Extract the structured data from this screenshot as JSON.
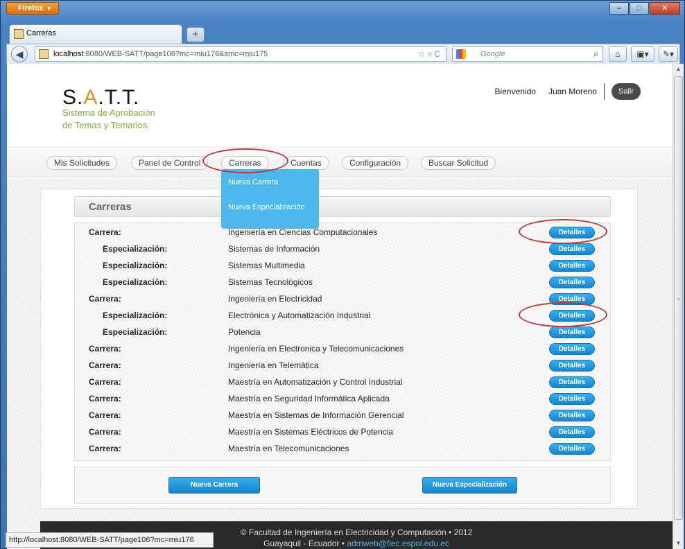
{
  "browser": {
    "app_menu": "Firefox",
    "tab_title": "Carreras",
    "new_tab": "+",
    "url_host": "localhost",
    "url_rest": ":8080/WEB-SATT/page106?mc=miu176&smc=miu175",
    "search_placeholder": "Google",
    "status_url": "http://localhost:8080/WEB-SATT/page106?mc=miu176"
  },
  "site": {
    "logo_s": "S.",
    "logo_a": "A",
    "logo_rest": ".T.T.",
    "tagline_1": "Sistema de Aprobación",
    "tagline_2": "de Temas y Temarios.",
    "welcome": "Bienvenido",
    "user_name": "Juan Moreno",
    "logout": "Salir"
  },
  "menu": {
    "items": [
      "Mis Solicitudes",
      "Panel de Control",
      "Carreras",
      "Cuentas",
      "Configuración",
      "Buscar Solicitud"
    ],
    "dropdown": [
      "Nueva Carrera",
      "Nueva Especialización"
    ]
  },
  "section": {
    "title": "Carreras",
    "detail_label": "Detalles",
    "rows": [
      {
        "label": "Carrera:",
        "type": "carrera",
        "value": "Ingeniería en Ciencias Computacionales"
      },
      {
        "label": "Especialización:",
        "type": "esp",
        "value": "Sistemas de Información"
      },
      {
        "label": "Especialización:",
        "type": "esp",
        "value": "Sistemas Multimedia"
      },
      {
        "label": "Especialización:",
        "type": "esp",
        "value": "Sistemas Tecnológicos"
      },
      {
        "label": "Carrera:",
        "type": "carrera",
        "value": "Ingeniería en Electricidad"
      },
      {
        "label": "Especialización:",
        "type": "esp",
        "value": "Electrónica y Automatización Industrial"
      },
      {
        "label": "Especialización:",
        "type": "esp",
        "value": "Potencia"
      },
      {
        "label": "Carrera:",
        "type": "carrera",
        "value": "Ingeniería en Electronica y Telecomunicaciones"
      },
      {
        "label": "Carrera:",
        "type": "carrera",
        "value": "Ingeniería en Telemática"
      },
      {
        "label": "Carrera:",
        "type": "carrera",
        "value": "Maestría en Automatización y Control Industrial"
      },
      {
        "label": "Carrera:",
        "type": "carrera",
        "value": "Maestría en Seguridad Informática Aplicada"
      },
      {
        "label": "Carrera:",
        "type": "carrera",
        "value": "Maestría en Sistemas de Información Gerencial"
      },
      {
        "label": "Carrera:",
        "type": "carrera",
        "value": "Maestría en Sistemas Eléctricos de Potencia"
      },
      {
        "label": "Carrera:",
        "type": "carrera",
        "value": "Maestría en Telecomunicaciones"
      }
    ],
    "btn_new_carrera": "Nueva Carrera",
    "btn_new_esp": "Nueva Especialización"
  },
  "footer": {
    "line1": "© Facultad de Ingeniería en Electricidad y Computación • 2012",
    "line2": "Guayaquil - Ecuador • ",
    "email": "admweb@fiec.espol.edu.ec"
  },
  "colors": {
    "accent": "#1a84cc",
    "dropdown": "#4db8ec",
    "tagline": "#7fae3a",
    "annotation": "#b83a3a"
  }
}
